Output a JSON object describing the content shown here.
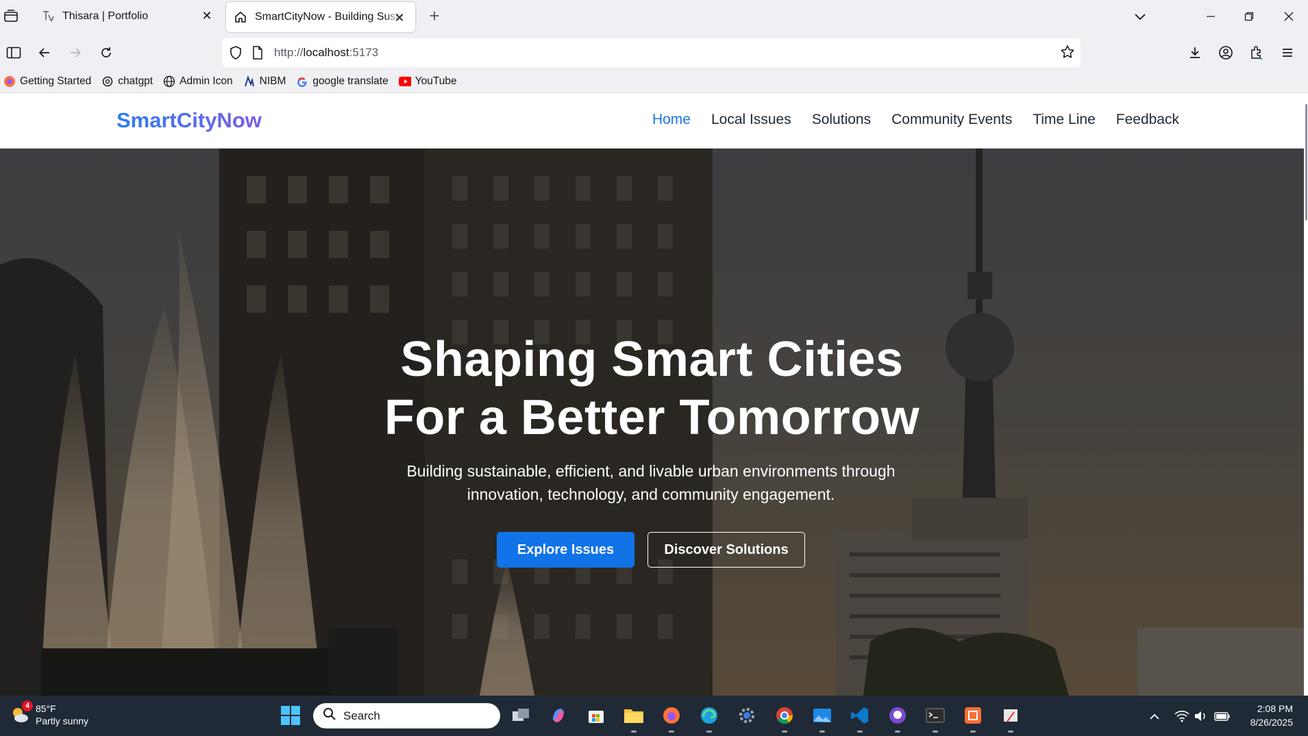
{
  "browser": {
    "tabs": [
      {
        "title": "Thisara | Portfolio",
        "icon": "page-translate-icon",
        "active": false
      },
      {
        "title": "SmartCityNow - Building Sustainable",
        "icon": "home-icon",
        "active": true
      }
    ],
    "url": {
      "scheme": "http://",
      "host": "localhost",
      "port": ":5173"
    },
    "bookmarks": [
      {
        "label": "Getting Started",
        "icon": "firefox-icon"
      },
      {
        "label": "chatgpt",
        "icon": "openai-icon"
      },
      {
        "label": "Admin Icon",
        "icon": "globe-icon"
      },
      {
        "label": "NIBM",
        "icon": "nibm-icon"
      },
      {
        "label": "google translate",
        "icon": "google-icon"
      },
      {
        "label": "YouTube",
        "icon": "youtube-icon"
      }
    ]
  },
  "site": {
    "logo": "SmartCityNow",
    "menu": [
      {
        "label": "Home",
        "active": true
      },
      {
        "label": "Local Issues",
        "active": false
      },
      {
        "label": "Solutions",
        "active": false
      },
      {
        "label": "Community Events",
        "active": false
      },
      {
        "label": "Time Line",
        "active": false
      },
      {
        "label": "Feedback",
        "active": false
      }
    ],
    "hero": {
      "title_line1": "Shaping Smart Cities",
      "title_line2": "For a Better Tomorrow",
      "subtitle": "Building sustainable, efficient, and livable urban environments through innovation, technology, and community engagement.",
      "primary_button": "Explore Issues",
      "secondary_button": "Discover Solutions"
    }
  },
  "taskbar": {
    "weather": {
      "temp": "85°F",
      "condition": "Partly sunny",
      "badge": "4"
    },
    "search_placeholder": "Search",
    "time": "2:08 PM",
    "date": "8/26/2025"
  },
  "colors": {
    "accent": "#1c74e9",
    "button_primary": "#1173e8",
    "logo_gradient_start": "#2d7ff0",
    "logo_gradient_end": "#7c5ce6",
    "taskbar": "#1f2a36"
  }
}
